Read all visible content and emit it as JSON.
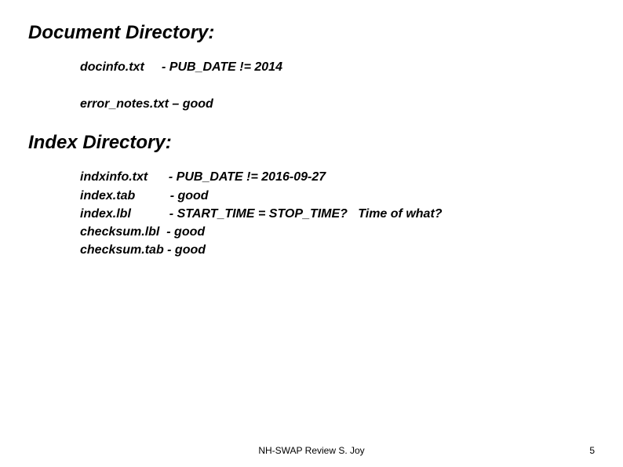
{
  "section1": {
    "heading": "Document Directory:",
    "line1": "docinfo.txt     - PUB_DATE != 2014",
    "line2": "error_notes.txt – good"
  },
  "section2": {
    "heading": "Index Directory:",
    "line1": "indxinfo.txt      - PUB_DATE != 2016-09-27",
    "line2": "index.tab          - good",
    "line3": "index.lbl           - START_TIME = STOP_TIME?   Time of what?",
    "line4": "checksum.lbl  - good",
    "line5": "checksum.tab - good"
  },
  "footer": {
    "center": "NH-SWAP Review S. Joy",
    "page": "5"
  }
}
